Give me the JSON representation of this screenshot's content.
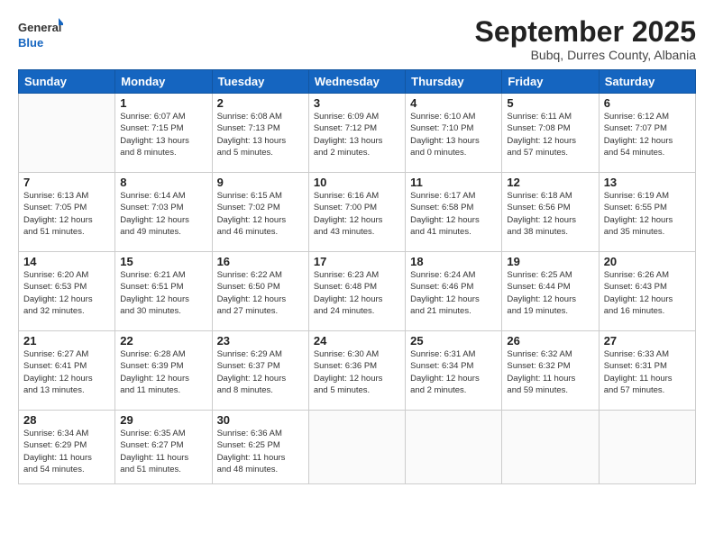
{
  "header": {
    "logo_general": "General",
    "logo_blue": "Blue",
    "month_title": "September 2025",
    "location": "Bubq, Durres County, Albania"
  },
  "days_of_week": [
    "Sunday",
    "Monday",
    "Tuesday",
    "Wednesday",
    "Thursday",
    "Friday",
    "Saturday"
  ],
  "weeks": [
    [
      {
        "day": "",
        "info": ""
      },
      {
        "day": "1",
        "info": "Sunrise: 6:07 AM\nSunset: 7:15 PM\nDaylight: 13 hours\nand 8 minutes."
      },
      {
        "day": "2",
        "info": "Sunrise: 6:08 AM\nSunset: 7:13 PM\nDaylight: 13 hours\nand 5 minutes."
      },
      {
        "day": "3",
        "info": "Sunrise: 6:09 AM\nSunset: 7:12 PM\nDaylight: 13 hours\nand 2 minutes."
      },
      {
        "day": "4",
        "info": "Sunrise: 6:10 AM\nSunset: 7:10 PM\nDaylight: 13 hours\nand 0 minutes."
      },
      {
        "day": "5",
        "info": "Sunrise: 6:11 AM\nSunset: 7:08 PM\nDaylight: 12 hours\nand 57 minutes."
      },
      {
        "day": "6",
        "info": "Sunrise: 6:12 AM\nSunset: 7:07 PM\nDaylight: 12 hours\nand 54 minutes."
      }
    ],
    [
      {
        "day": "7",
        "info": "Sunrise: 6:13 AM\nSunset: 7:05 PM\nDaylight: 12 hours\nand 51 minutes."
      },
      {
        "day": "8",
        "info": "Sunrise: 6:14 AM\nSunset: 7:03 PM\nDaylight: 12 hours\nand 49 minutes."
      },
      {
        "day": "9",
        "info": "Sunrise: 6:15 AM\nSunset: 7:02 PM\nDaylight: 12 hours\nand 46 minutes."
      },
      {
        "day": "10",
        "info": "Sunrise: 6:16 AM\nSunset: 7:00 PM\nDaylight: 12 hours\nand 43 minutes."
      },
      {
        "day": "11",
        "info": "Sunrise: 6:17 AM\nSunset: 6:58 PM\nDaylight: 12 hours\nand 41 minutes."
      },
      {
        "day": "12",
        "info": "Sunrise: 6:18 AM\nSunset: 6:56 PM\nDaylight: 12 hours\nand 38 minutes."
      },
      {
        "day": "13",
        "info": "Sunrise: 6:19 AM\nSunset: 6:55 PM\nDaylight: 12 hours\nand 35 minutes."
      }
    ],
    [
      {
        "day": "14",
        "info": "Sunrise: 6:20 AM\nSunset: 6:53 PM\nDaylight: 12 hours\nand 32 minutes."
      },
      {
        "day": "15",
        "info": "Sunrise: 6:21 AM\nSunset: 6:51 PM\nDaylight: 12 hours\nand 30 minutes."
      },
      {
        "day": "16",
        "info": "Sunrise: 6:22 AM\nSunset: 6:50 PM\nDaylight: 12 hours\nand 27 minutes."
      },
      {
        "day": "17",
        "info": "Sunrise: 6:23 AM\nSunset: 6:48 PM\nDaylight: 12 hours\nand 24 minutes."
      },
      {
        "day": "18",
        "info": "Sunrise: 6:24 AM\nSunset: 6:46 PM\nDaylight: 12 hours\nand 21 minutes."
      },
      {
        "day": "19",
        "info": "Sunrise: 6:25 AM\nSunset: 6:44 PM\nDaylight: 12 hours\nand 19 minutes."
      },
      {
        "day": "20",
        "info": "Sunrise: 6:26 AM\nSunset: 6:43 PM\nDaylight: 12 hours\nand 16 minutes."
      }
    ],
    [
      {
        "day": "21",
        "info": "Sunrise: 6:27 AM\nSunset: 6:41 PM\nDaylight: 12 hours\nand 13 minutes."
      },
      {
        "day": "22",
        "info": "Sunrise: 6:28 AM\nSunset: 6:39 PM\nDaylight: 12 hours\nand 11 minutes."
      },
      {
        "day": "23",
        "info": "Sunrise: 6:29 AM\nSunset: 6:37 PM\nDaylight: 12 hours\nand 8 minutes."
      },
      {
        "day": "24",
        "info": "Sunrise: 6:30 AM\nSunset: 6:36 PM\nDaylight: 12 hours\nand 5 minutes."
      },
      {
        "day": "25",
        "info": "Sunrise: 6:31 AM\nSunset: 6:34 PM\nDaylight: 12 hours\nand 2 minutes."
      },
      {
        "day": "26",
        "info": "Sunrise: 6:32 AM\nSunset: 6:32 PM\nDaylight: 11 hours\nand 59 minutes."
      },
      {
        "day": "27",
        "info": "Sunrise: 6:33 AM\nSunset: 6:31 PM\nDaylight: 11 hours\nand 57 minutes."
      }
    ],
    [
      {
        "day": "28",
        "info": "Sunrise: 6:34 AM\nSunset: 6:29 PM\nDaylight: 11 hours\nand 54 minutes."
      },
      {
        "day": "29",
        "info": "Sunrise: 6:35 AM\nSunset: 6:27 PM\nDaylight: 11 hours\nand 51 minutes."
      },
      {
        "day": "30",
        "info": "Sunrise: 6:36 AM\nSunset: 6:25 PM\nDaylight: 11 hours\nand 48 minutes."
      },
      {
        "day": "",
        "info": ""
      },
      {
        "day": "",
        "info": ""
      },
      {
        "day": "",
        "info": ""
      },
      {
        "day": "",
        "info": ""
      }
    ]
  ]
}
